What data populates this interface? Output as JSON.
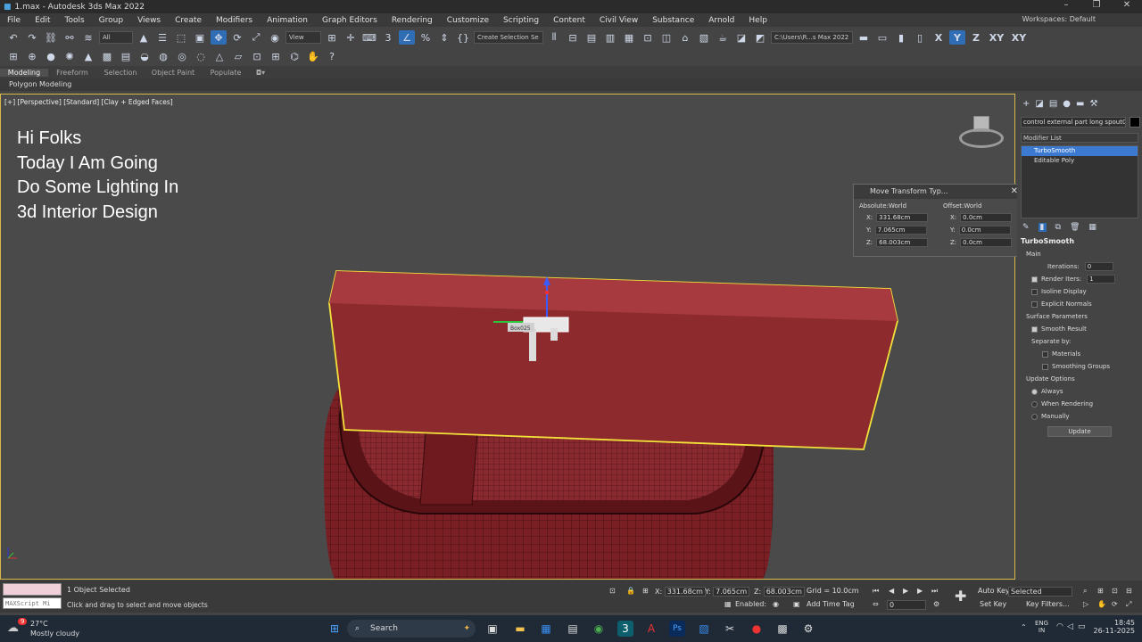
{
  "window": {
    "title": "1.max - Autodesk 3ds Max 2022"
  },
  "menu": {
    "items": [
      "File",
      "Edit",
      "Tools",
      "Group",
      "Views",
      "Create",
      "Modifiers",
      "Animation",
      "Graph Editors",
      "Rendering",
      "Customize",
      "Scripting",
      "Content",
      "Civil View",
      "Substance",
      "Arnold",
      "Help"
    ],
    "workspaces_label": "Workspaces:",
    "workspaces_value": "Default"
  },
  "toolbar": {
    "filter": "All",
    "view": "View",
    "selection_set": "Create Selection Se",
    "path": "C:\\Users\\R...s Max 2022",
    "axes": [
      "X",
      "Y",
      "Z",
      "XY",
      "XY"
    ]
  },
  "ribbon": {
    "tabs": [
      "Modeling",
      "Freeform",
      "Selection",
      "Object Paint",
      "Populate"
    ],
    "sub": "Polygon Modeling"
  },
  "viewport": {
    "label": "[+] [Perspective] [Standard] [Clay + Edged Faces]",
    "overlay": [
      "Hi Folks",
      "Today I Am Going",
      "Do Some Lighting In",
      "3d Interior Design"
    ],
    "object_tag": "Box025"
  },
  "command_panel": {
    "object_name": "control external part long spout001",
    "modifier_list": "Modifier List",
    "stack": [
      "TurboSmooth",
      "Editable Poly"
    ],
    "turbosmooth": {
      "title": "TurboSmooth",
      "main": "Main",
      "iterations_label": "Iterations:",
      "iterations": "0",
      "render_iters_label": "Render Iters:",
      "render_iters": "1",
      "isoline": "Isoline Display",
      "explicit": "Explicit Normals",
      "surface": "Surface Parameters",
      "smooth_result": "Smooth Result",
      "separate": "Separate by:",
      "materials": "Materials",
      "smoothing_groups": "Smoothing Groups",
      "update_options": "Update Options",
      "always": "Always",
      "when_rendering": "When Rendering",
      "manually": "Manually",
      "update_btn": "Update"
    }
  },
  "move_dialog": {
    "title": "Move Transform Typ...",
    "abs_header": "Absolute:World",
    "off_header": "Offset:World",
    "abs": {
      "x": "331.68cm",
      "y": "7.065cm",
      "z": "68.003cm"
    },
    "off": {
      "x": "0.0cm",
      "y": "0.0cm",
      "z": "0.0cm"
    }
  },
  "status": {
    "maxscript": "MAXScript Mi",
    "selected": "1 Object Selected",
    "hint": "Click and drag to select and move objects",
    "x": "331.68cm",
    "y": "7.065cm",
    "z": "68.003cm",
    "grid": "Grid = 10.0cm",
    "enabled": "Enabled:",
    "add_time_tag": "Add Time Tag",
    "frame": "0",
    "auto_key": "Auto Key",
    "set_key": "Set Key",
    "selected_dd": "Selected",
    "key_filters": "Key Filters..."
  },
  "taskbar": {
    "weather_temp": "27°C",
    "weather_desc": "Mostly cloudy",
    "search": "Search",
    "lang1": "ENG",
    "lang2": "IN",
    "time": "18:45",
    "date": "26-11-2025",
    "badge": "9"
  }
}
